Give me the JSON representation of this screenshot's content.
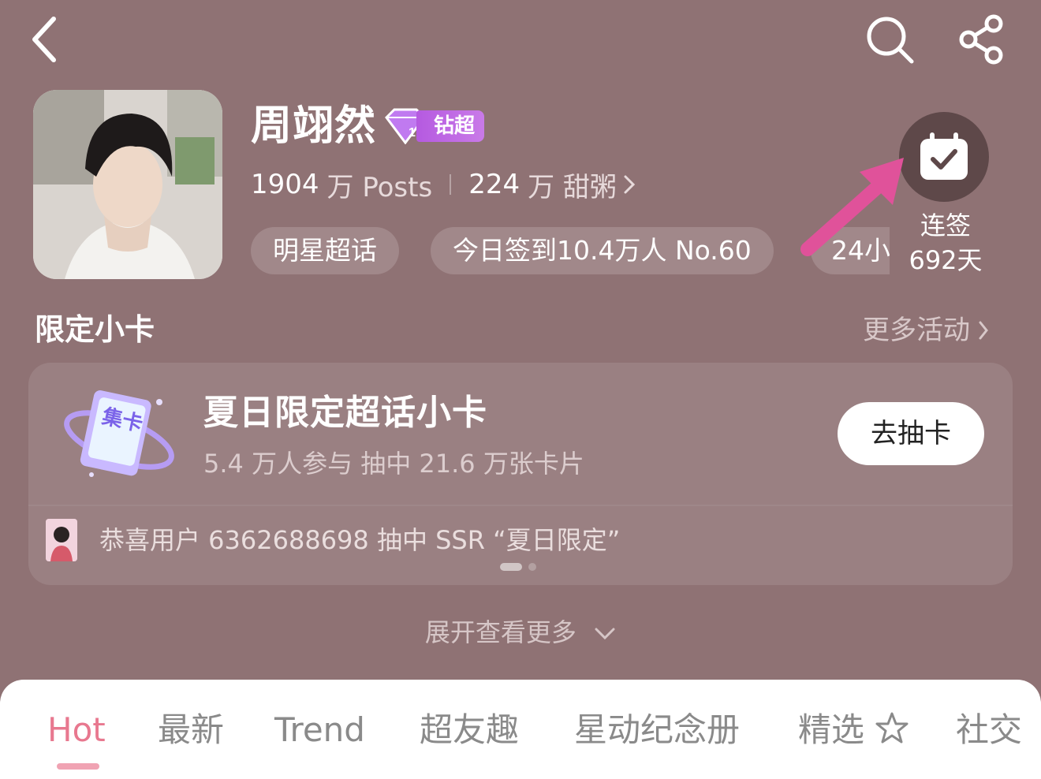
{
  "header": {
    "back_icon": "chevron-left-icon",
    "search_icon": "search-icon",
    "share_icon": "share-icon"
  },
  "profile": {
    "name": "周翊然",
    "badge_label": "钻超",
    "posts_count": "1904",
    "posts_unit": "万 Posts",
    "fans_count": "224",
    "fans_unit": "万 甜粥",
    "tags": [
      "明星超话",
      "今日签到10.4万人 No.60",
      "24小"
    ],
    "checkin_label_line1": "连签",
    "checkin_label_line2": "692天"
  },
  "section": {
    "title": "限定小卡",
    "more_link": "更多活动"
  },
  "card": {
    "illustration_text": "集卡",
    "title": "夏日限定超话小卡",
    "subtitle": "5.4 万人参与  抽中 21.6 万张卡片",
    "button": "去抽卡",
    "winner": "恭喜用户 6362688698 抽中 SSR “夏日限定”"
  },
  "expand_label": "展开查看更多",
  "tabs": [
    {
      "label": "Hot",
      "active": true
    },
    {
      "label": "最新"
    },
    {
      "label": "Trend"
    },
    {
      "label": "超友趣"
    },
    {
      "label": "星动纪念册"
    },
    {
      "label": "精选"
    },
    {
      "label": "社交"
    }
  ],
  "colors": {
    "background": "#8f7274",
    "accent_pink": "#e8788f",
    "badge_purple": "#b55ae0",
    "arrow_pink": "#e0529a"
  }
}
